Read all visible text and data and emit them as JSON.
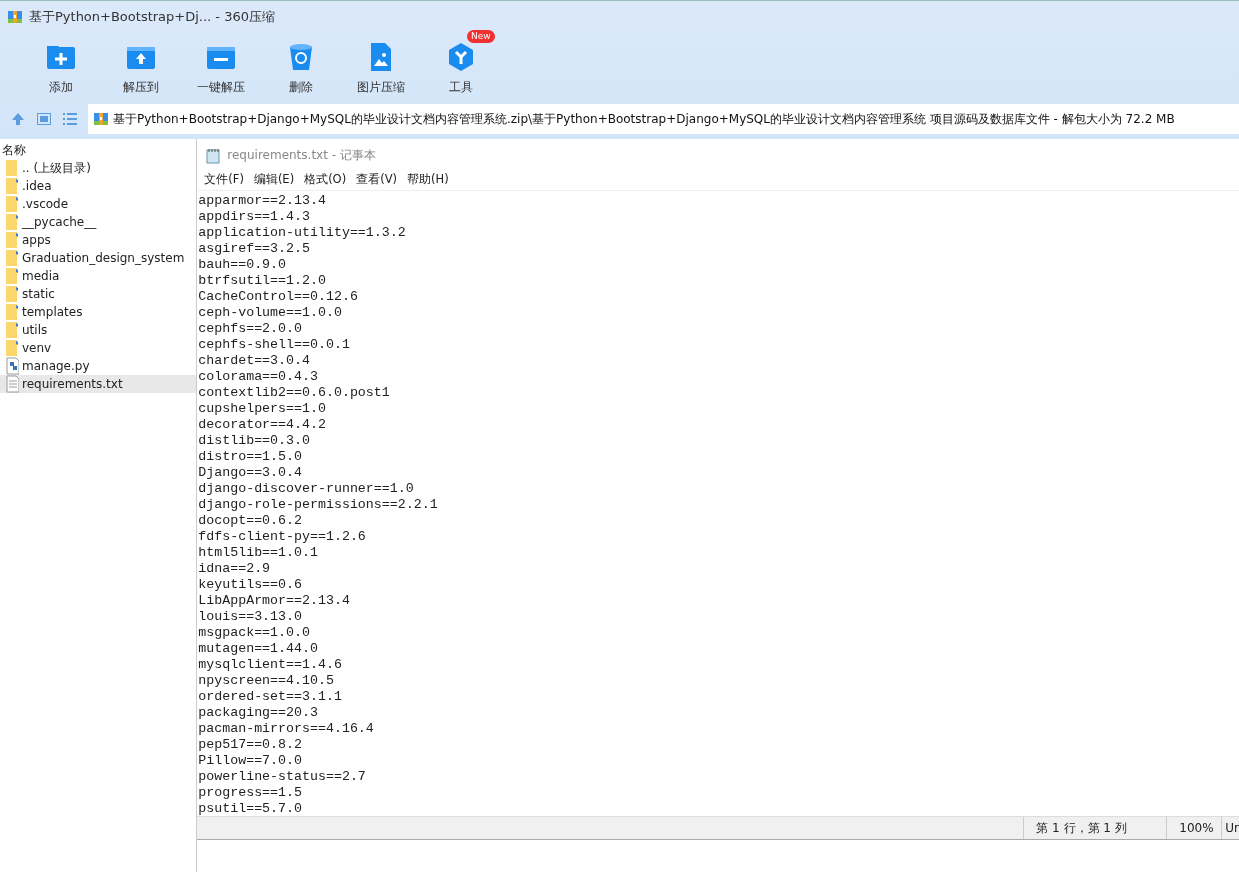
{
  "window": {
    "title": "基于Python+Bootstrap+Dj... - 360压缩"
  },
  "toolbar": [
    {
      "kind": "add",
      "label": "添加"
    },
    {
      "kind": "extract",
      "label": "解压到"
    },
    {
      "kind": "oneclick",
      "label": "一键解压"
    },
    {
      "kind": "delete",
      "label": "删除"
    },
    {
      "kind": "image",
      "label": "图片压缩"
    },
    {
      "kind": "tools",
      "label": "工具",
      "badge": "New"
    }
  ],
  "address": "基于Python+Bootstrap+Django+MySQL的毕业设计文档内容管理系统.zip\\基于Python+Bootstrap+Django+MySQL的毕业设计文档内容管理系统 项目源码及数据库文件 - 解包大小为 72.2 MB",
  "file_list": {
    "header": "名称",
    "items": [
      {
        "kind": "folder",
        "name": ".. (上级目录)",
        "selected": false
      },
      {
        "kind": "folder",
        "name": ".idea",
        "selected": false
      },
      {
        "kind": "folder",
        "name": ".vscode",
        "selected": false
      },
      {
        "kind": "folder",
        "name": "__pycache__",
        "selected": false
      },
      {
        "kind": "folder",
        "name": "apps",
        "selected": false
      },
      {
        "kind": "folder",
        "name": "Graduation_design_system",
        "selected": false
      },
      {
        "kind": "folder",
        "name": "media",
        "selected": false
      },
      {
        "kind": "folder",
        "name": "static",
        "selected": false
      },
      {
        "kind": "folder",
        "name": "templates",
        "selected": false
      },
      {
        "kind": "folder",
        "name": "utils",
        "selected": false
      },
      {
        "kind": "folder",
        "name": "venv",
        "selected": false
      },
      {
        "kind": "python",
        "name": "manage.py",
        "selected": false
      },
      {
        "kind": "text",
        "name": "requirements.txt",
        "selected": true
      }
    ]
  },
  "notepad": {
    "title": "requirements.txt - 记事本",
    "menu": [
      "文件(F)",
      "编辑(E)",
      "格式(O)",
      "查看(V)",
      "帮助(H)"
    ],
    "lines": [
      "apparmor==2.13.4",
      "appdirs==1.4.3",
      "application-utility==1.3.2",
      "asgiref==3.2.5",
      "bauh==0.9.0",
      "btrfsutil==1.2.0",
      "CacheControl==0.12.6",
      "ceph-volume==1.0.0",
      "cephfs==2.0.0",
      "cephfs-shell==0.0.1",
      "chardet==3.0.4",
      "colorama==0.4.3",
      "contextlib2==0.6.0.post1",
      "cupshelpers==1.0",
      "decorator==4.4.2",
      "distlib==0.3.0",
      "distro==1.5.0",
      "Django==3.0.4",
      "django-discover-runner==1.0",
      "django-role-permissions==2.2.1",
      "docopt==0.6.2",
      "fdfs-client-py==1.2.6",
      "html5lib==1.0.1",
      "idna==2.9",
      "keyutils==0.6",
      "LibAppArmor==2.13.4",
      "louis==3.13.0",
      "msgpack==1.0.0",
      "mutagen==1.44.0",
      "mysqlclient==1.4.6",
      "npyscreen==4.10.5",
      "ordered-set==3.1.1",
      "packaging==20.3",
      "pacman-mirrors==4.16.4",
      "pep517==0.8.2",
      "Pillow==7.0.0",
      "powerline-status==2.7",
      "progress==1.5",
      "psutil==5.7.0"
    ],
    "status": [
      "第 1 行，第 1 列",
      "100%",
      "Ur"
    ]
  }
}
